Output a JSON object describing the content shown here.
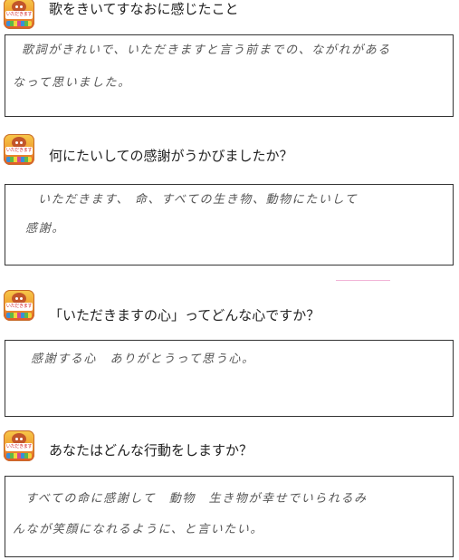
{
  "questions": [
    {
      "icon_label": "いただきます",
      "question": "歌をきいてすなおに感じたこと",
      "answer_lines": [
        "歌詞がきれいで、いただきますと言う前までの、ながれがある",
        "なって思いました。"
      ]
    },
    {
      "icon_label": "いただきます",
      "question": "何にたいしての感謝がうかびましたか？",
      "answer_lines": [
        "いただきます、 命、すべての生き物、動物にたいして",
        "感謝。"
      ]
    },
    {
      "icon_label": "いただきます",
      "question": "「いただきますの心」ってどんな心ですか？",
      "answer_lines": [
        "感謝する心　ありがとうって思う心。"
      ]
    },
    {
      "icon_label": "いただきます",
      "question": "あなたはどんな行動をしますか？",
      "answer_lines": [
        "すべての命に感謝して　動物　生き物が幸せでいられるみ",
        "んなが笑顔になれるように、と言いたい。"
      ]
    }
  ]
}
